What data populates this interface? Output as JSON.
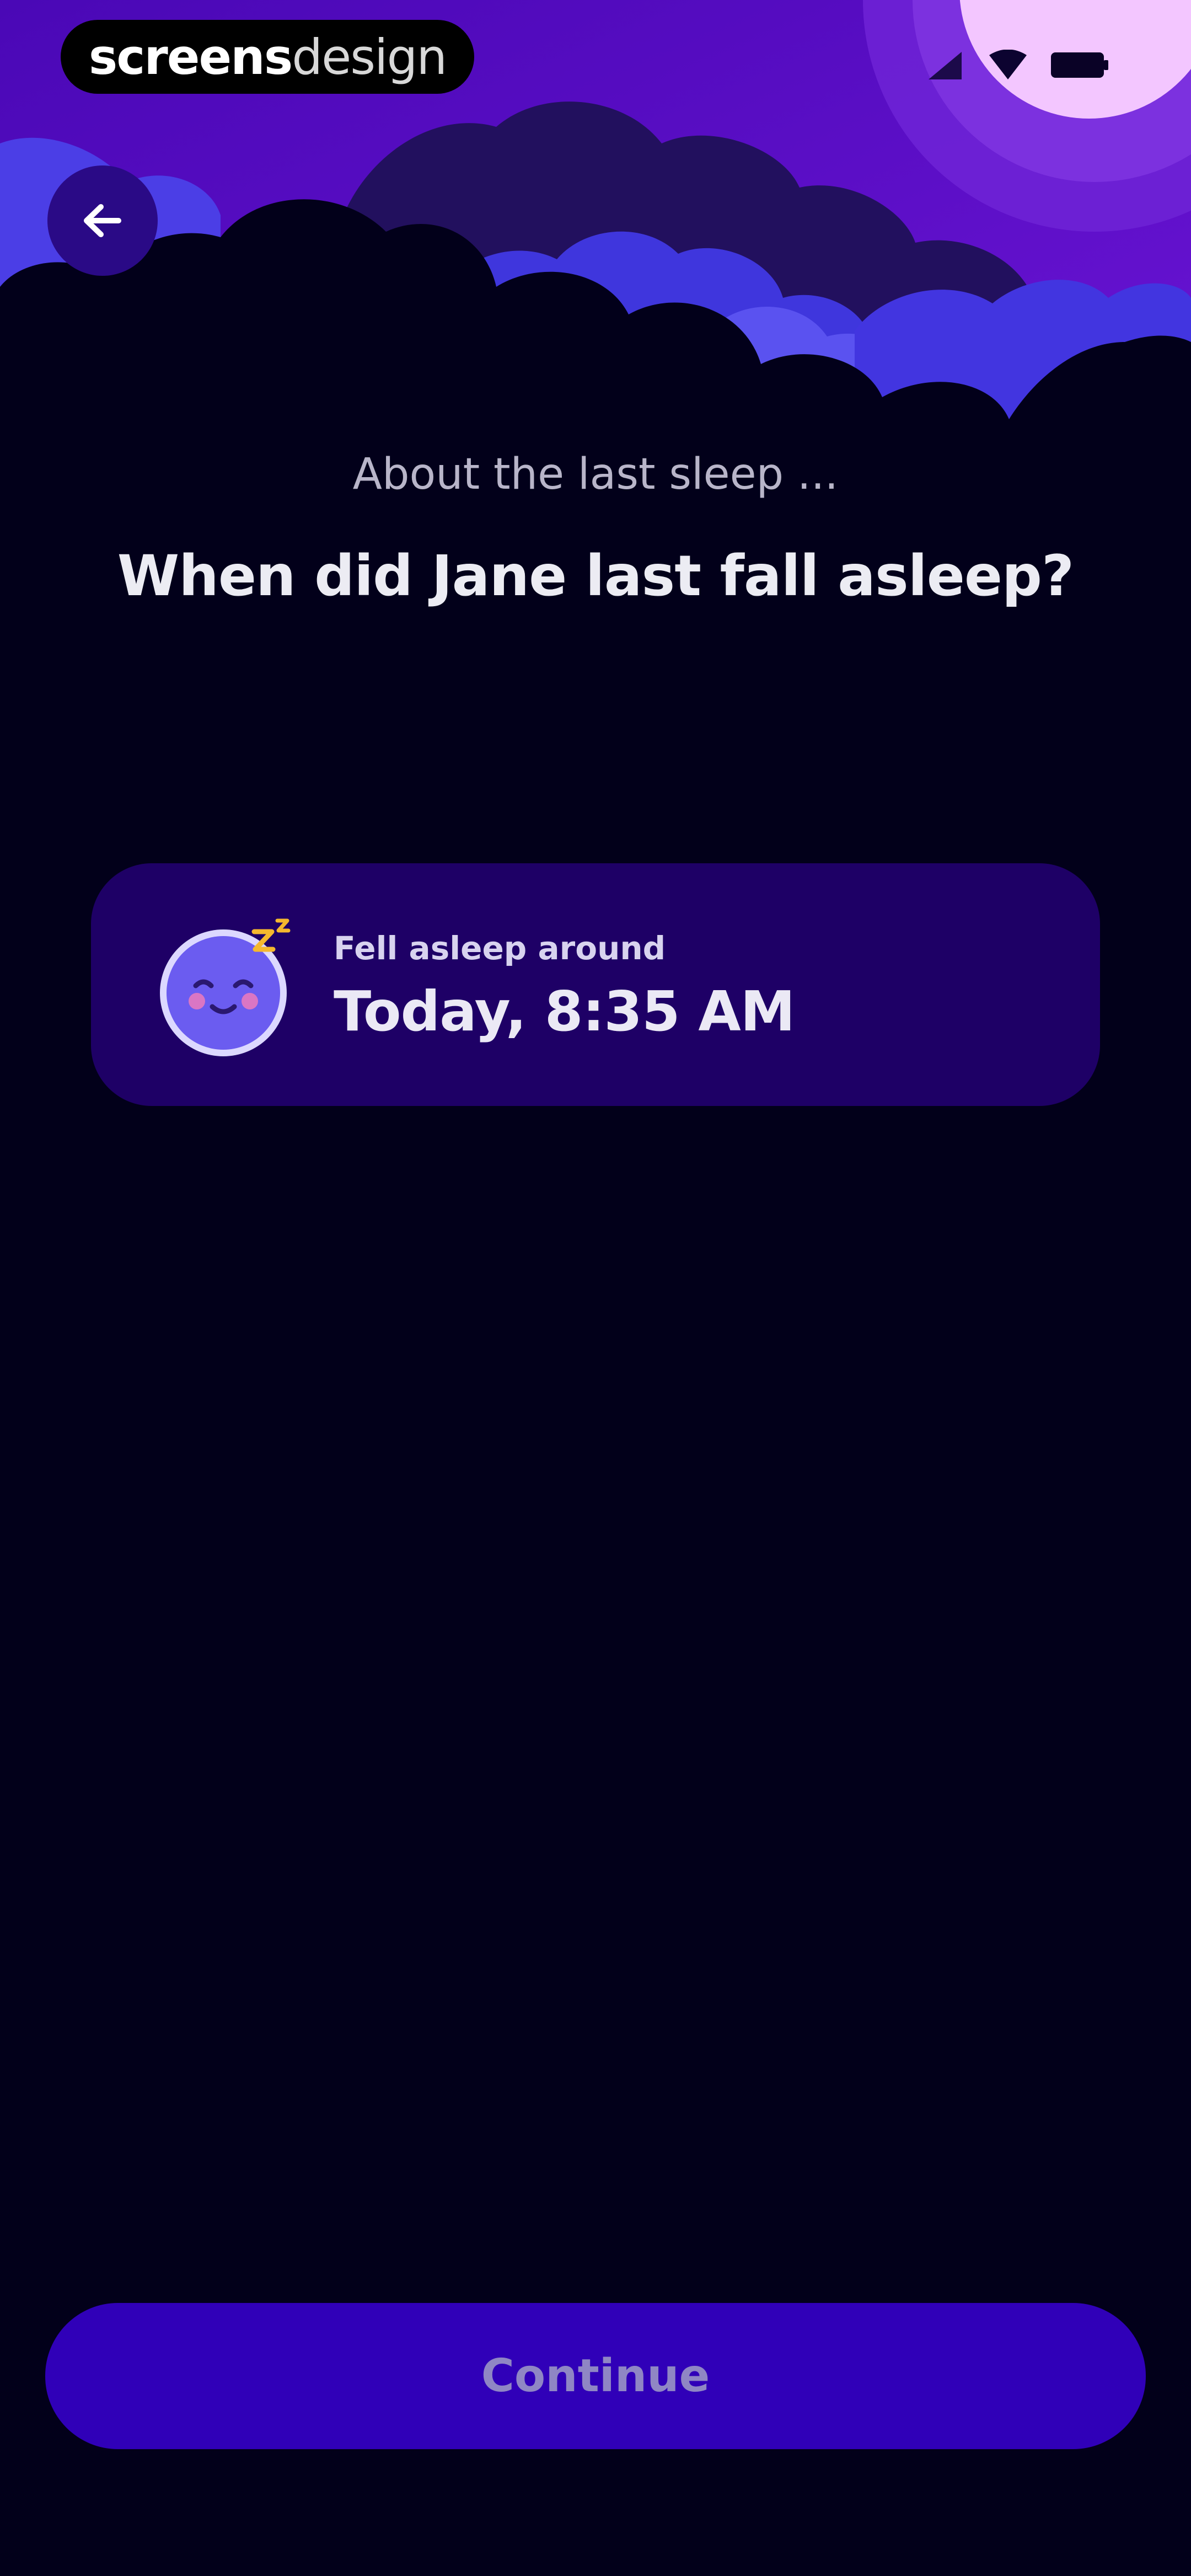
{
  "status_bar": {
    "brand_strong": "screens",
    "brand_light": "design",
    "icons": [
      "signal-icon",
      "wifi-icon",
      "battery-icon"
    ]
  },
  "header": {
    "back_icon": "arrow-left-icon"
  },
  "content": {
    "subtitle": "About the last sleep ...",
    "title": "When did Jane last fall asleep?"
  },
  "sleep_card": {
    "icon": "moon-face-icon",
    "label": "Fell asleep around",
    "value": "Today, 8:35 AM"
  },
  "footer": {
    "continue_label": "Continue"
  },
  "colors": {
    "background": "#02001a",
    "card": "#1e0066",
    "button": "#3000b8",
    "sky_purple": "#5a0fc8",
    "cloud_blue": "#4b3ee6",
    "moon": "#f3c6ff"
  }
}
